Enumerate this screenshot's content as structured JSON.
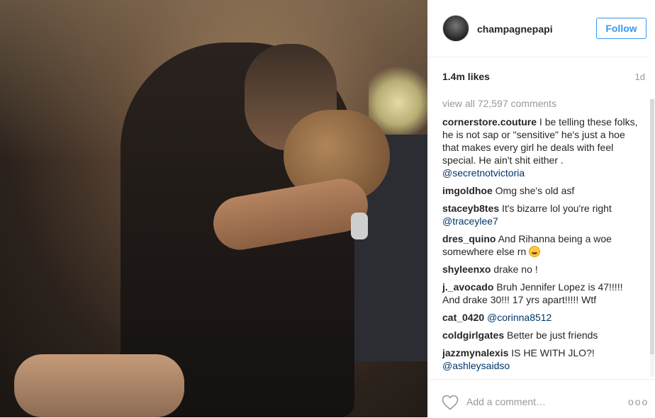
{
  "post": {
    "username": "champagnepapi",
    "follow_label": "Follow",
    "likes": "1.4m likes",
    "time": "1d",
    "view_all": "view all 72,597 comments",
    "add_comment_placeholder": "Add a comment…",
    "more_label": "ooo"
  },
  "comments": [
    {
      "user": "cornerstore.couture",
      "text": " I be telling these folks, he is not sap or \"sensitive\" he's just a hoe that makes every girl he deals with feel special. He ain't shit either . ",
      "mention": "@secretnotvictoria"
    },
    {
      "user": "imgoldhoe",
      "text": " Omg she's old asf",
      "mention": ""
    },
    {
      "user": "staceyb8tes",
      "text": " It's bizarre lol you're right ",
      "mention": "@traceylee7"
    },
    {
      "user": "dres_quino",
      "text": " And Rihanna being a woe somewhere else rn ",
      "mention": ""
    },
    {
      "user": "shyleenxo",
      "text": " drake no !",
      "mention": ""
    },
    {
      "user": "j._avocado",
      "text": " Bruh Jennifer Lopez is 47!!!!! And drake 30!!! 17 yrs apart!!!!! Wtf",
      "mention": ""
    },
    {
      "user": "cat_0420",
      "text": " ",
      "mention": "@corinna8512"
    },
    {
      "user": "coldgirlgates",
      "text": " Better be just friends",
      "mention": ""
    },
    {
      "user": "jazzmynalexis",
      "text": " IS HE WITH JLO?! ",
      "mention": "@ashleysaidso"
    }
  ],
  "icons": {
    "heart": "heart-icon",
    "emoji": "laughing-emoji-icon",
    "avatar": "avatar"
  },
  "colors": {
    "accent": "#3897f0",
    "mention": "#003569",
    "muted": "#999999"
  }
}
